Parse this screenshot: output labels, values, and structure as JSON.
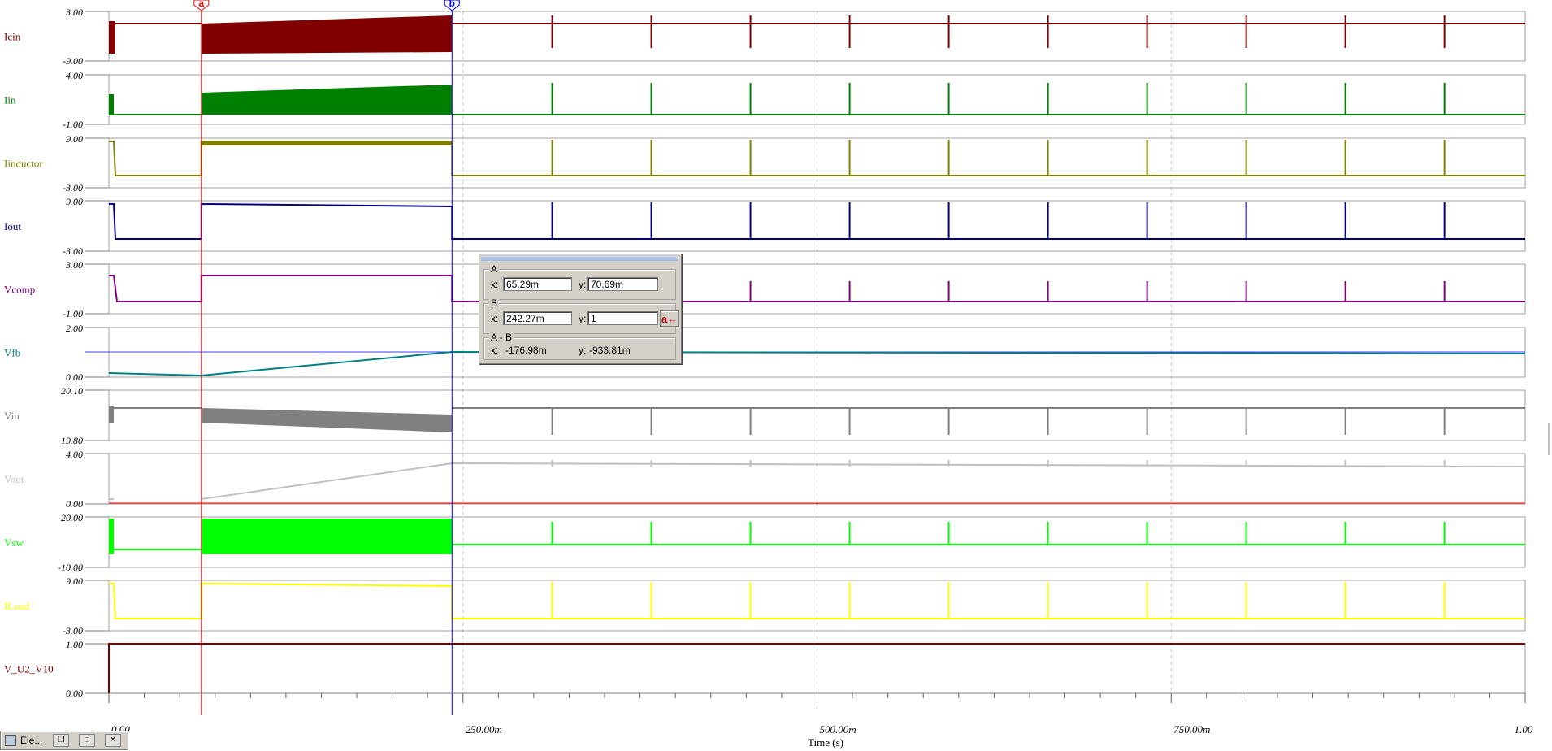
{
  "app": {
    "window_label": "Ele..."
  },
  "x_axis": {
    "label": "Time (s)",
    "ticks": [
      {
        "value": 0,
        "label": "0.00"
      },
      {
        "value": 0.25,
        "label": "250.00m"
      },
      {
        "value": 0.5,
        "label": "500.00m"
      },
      {
        "value": 0.75,
        "label": "750.00m"
      },
      {
        "value": 1.0,
        "label": "1.00"
      }
    ],
    "range": [
      0,
      1.0
    ]
  },
  "cursors": {
    "a": {
      "x": 0.06529,
      "label": "a",
      "color": "#ff0000"
    },
    "b": {
      "x": 0.24227,
      "label": "b",
      "color": "#0000ff"
    }
  },
  "cursor_panel": {
    "a_title": "A",
    "a_x_label": "x:",
    "a_x": "65.29m",
    "a_y_label": "y:",
    "a_y": "70.69m",
    "b_title": "B",
    "b_x_label": "x:",
    "b_x": "242.27m",
    "b_y_label": "y:",
    "b_y": "1",
    "b_button": "a←",
    "diff_title": "A - B",
    "diff_x_label": "x:",
    "diff_x": "-176.98m",
    "diff_y_label": "y:",
    "diff_y": "-933.81m"
  },
  "chart_data": {
    "type": "line",
    "x_unit": "s",
    "panels": [
      {
        "name": "Icin",
        "color": "#800000",
        "ymax_label": "3.00",
        "ymin_label": "-9.00",
        "style": "icin"
      },
      {
        "name": "Iin",
        "color": "#008000",
        "ymax_label": "4.00",
        "ymin_label": "-1.00",
        "style": "iin"
      },
      {
        "name": "Iinductor",
        "color": "#808000",
        "ymax_label": "9.00",
        "ymin_label": "-3.00",
        "style": "step"
      },
      {
        "name": "Iout",
        "color": "#000080",
        "ymax_label": "9.00",
        "ymin_label": "-3.00",
        "style": "step"
      },
      {
        "name": "Vcomp",
        "color": "#800080",
        "ymax_label": "3.00",
        "ymin_label": "-1.00",
        "style": "vcomp"
      },
      {
        "name": "Vfb",
        "color": "#008080",
        "ymax_label": "2.00",
        "ymin_label": "0.00",
        "style": "vfb"
      },
      {
        "name": "Vin",
        "color": "#808080",
        "ymax_label": "20.10",
        "ymin_label": "19.80",
        "style": "vin"
      },
      {
        "name": "Vout",
        "color": "#c0c0c0",
        "ymax_label": "4.00",
        "ymin_label": "0.00",
        "style": "vout"
      },
      {
        "name": "Vsw",
        "color": "#00ff00",
        "ymax_label": "20.00",
        "ymin_label": "-10.00",
        "style": "vsw"
      },
      {
        "name": "ILoad",
        "color": "#ffff00",
        "ymax_label": "9.00",
        "ymin_label": "-3.00",
        "style": "step"
      },
      {
        "name": "V_U2_V10",
        "color": "#800000",
        "ymax_label": "1.00",
        "ymin_label": "0.00",
        "style": "flat"
      }
    ],
    "spike_times": [
      0.313,
      0.383,
      0.453,
      0.523,
      0.593,
      0.663,
      0.733,
      0.803,
      0.873,
      0.943
    ]
  }
}
